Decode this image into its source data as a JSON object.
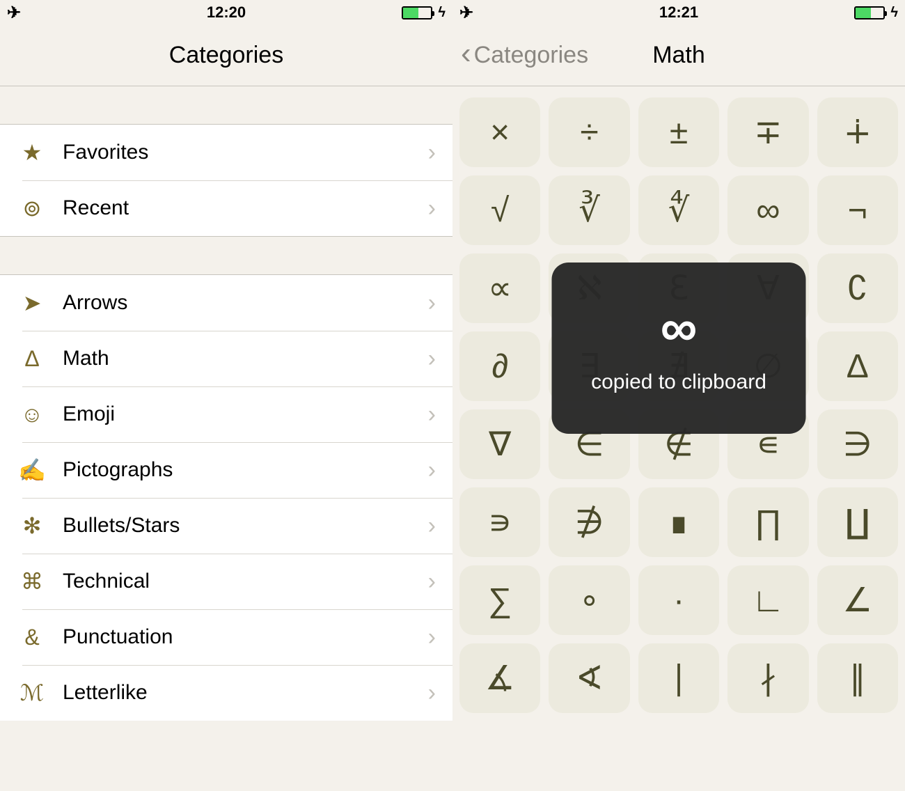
{
  "left": {
    "status": {
      "time": "12:20"
    },
    "nav": {
      "title": "Categories"
    },
    "group1": [
      {
        "icon": "★",
        "label": "Favorites",
        "name": "favorites"
      },
      {
        "icon": "⊚",
        "label": "Recent",
        "name": "recent"
      }
    ],
    "group2": [
      {
        "icon": "➤",
        "label": "Arrows",
        "name": "arrows"
      },
      {
        "icon": "Δ",
        "label": "Math",
        "name": "math"
      },
      {
        "icon": "☺",
        "label": "Emoji",
        "name": "emoji"
      },
      {
        "icon": "✍",
        "label": "Pictographs",
        "name": "pictographs"
      },
      {
        "icon": "✻",
        "label": "Bullets/Stars",
        "name": "bullets-stars"
      },
      {
        "icon": "⌘",
        "label": "Technical",
        "name": "technical"
      },
      {
        "icon": "&",
        "label": "Punctuation",
        "name": "punctuation"
      },
      {
        "icon": "ℳ",
        "label": "Letterlike",
        "name": "letterlike"
      }
    ]
  },
  "right": {
    "status": {
      "time": "12:21"
    },
    "nav": {
      "back": "Categories",
      "title": "Math"
    },
    "symbols": [
      "×",
      "÷",
      "±",
      "∓",
      "∔",
      "√",
      "∛",
      "∜",
      "∞",
      "¬",
      "∝",
      "ℵ",
      "ℇ",
      "∀",
      "∁",
      "∂",
      "∃",
      "∄",
      "∅",
      "∆",
      "∇",
      "∈",
      "∉",
      "∊",
      "∋",
      "∍",
      "∌",
      "∎",
      "∏",
      "∐",
      "∑",
      "∘",
      "∙",
      "∟",
      "∠",
      "∡",
      "∢",
      "∣",
      "∤",
      "∥"
    ],
    "toast": {
      "symbol": "∞",
      "message": "copied to clipboard"
    }
  },
  "colors": {
    "grid_bg": "#eceade",
    "page_bg": "#f4f1eb",
    "icon_color": "#7a6a2c",
    "battery_green": "#4cd964"
  }
}
